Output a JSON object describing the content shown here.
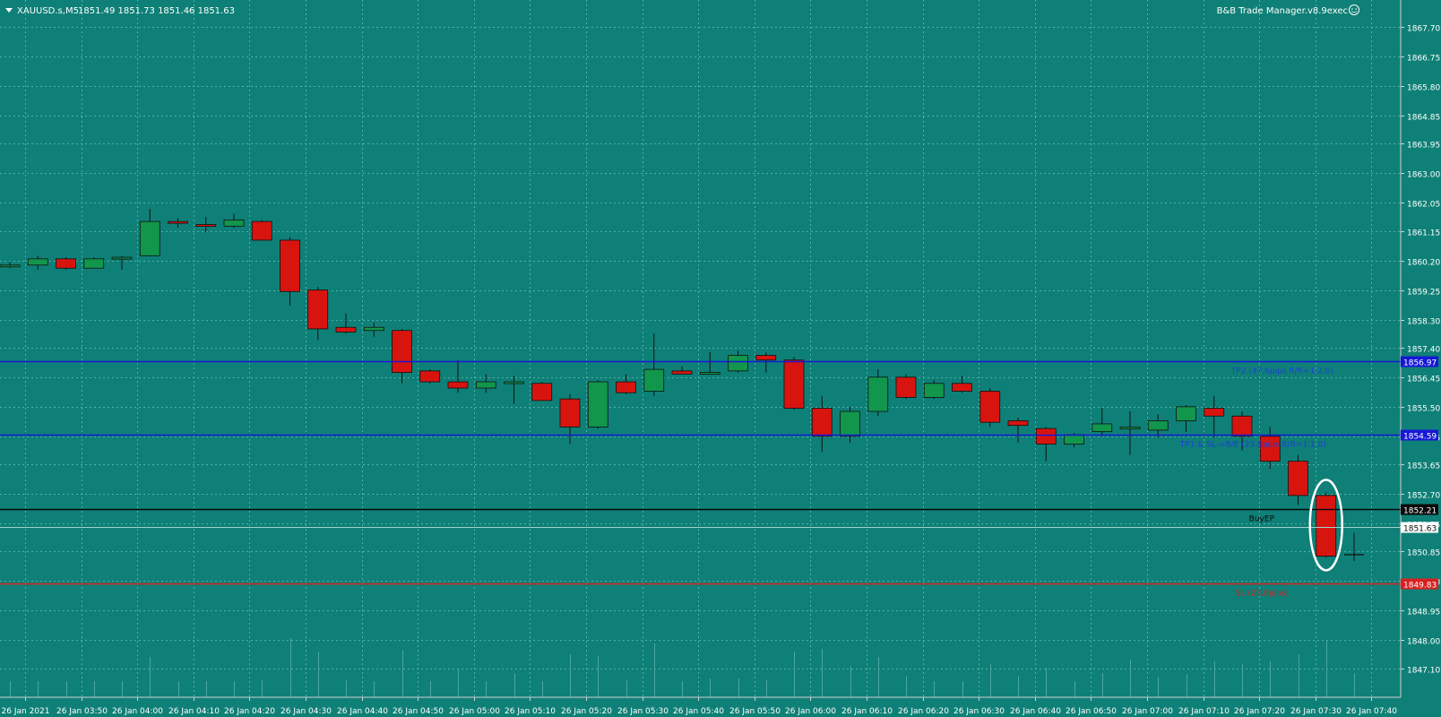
{
  "header": {
    "symbol_label": "XAUUSD.s,M5",
    "ohlc_label": "1851.49 1851.73 1851.46 1851.63",
    "ea_label": "B&B Trade Manager.v8.9exec"
  },
  "colors": {
    "background": "#0f8077",
    "grid": "#4fb0a6",
    "bull": "#11964c",
    "bear": "#d8140f",
    "wick": "#101010",
    "tp_line": "#1717d8",
    "entry_line": "#0a0a0a",
    "sl_line": "#d82020",
    "annotation": "#ffffff"
  },
  "chart_data": {
    "type": "candlestick",
    "symbol": "XAUUSD.s",
    "timeframe": "M5",
    "y_ticks": [
      "1867.70",
      "1866.75",
      "1865.80",
      "1864.85",
      "1863.95",
      "1863.00",
      "1862.05",
      "1861.15",
      "1860.20",
      "1859.25",
      "1858.30",
      "1857.40",
      "1856.45",
      "1855.50",
      "1854.55",
      "1853.65",
      "1852.70",
      "1851.75",
      "1850.85",
      "1849.90",
      "1848.95",
      "1848.00",
      "1847.10"
    ],
    "x_ticks": [
      "26 Jan 2021",
      "26 Jan 03:50",
      "26 Jan 04:00",
      "26 Jan 04:10",
      "26 Jan 04:20",
      "26 Jan 04:30",
      "26 Jan 04:40",
      "26 Jan 04:50",
      "26 Jan 05:00",
      "26 Jan 05:10",
      "26 Jan 05:20",
      "26 Jan 05:30",
      "26 Jan 05:40",
      "26 Jan 05:50",
      "26 Jan 06:00",
      "26 Jan 06:10",
      "26 Jan 06:20",
      "26 Jan 06:30",
      "26 Jan 06:40",
      "26 Jan 06:50",
      "26 Jan 07:00",
      "26 Jan 07:10",
      "26 Jan 07:20",
      "26 Jan 07:30",
      "26 Jan 07:40"
    ],
    "ylim": [
      1847.0,
      1868.1
    ],
    "candles": [
      {
        "o": 1860.05,
        "h": 1860.15,
        "l": 1859.95,
        "c": 1860.05
      },
      {
        "o": 1860.05,
        "h": 1860.35,
        "l": 1859.9,
        "c": 1860.25
      },
      {
        "o": 1860.25,
        "h": 1860.3,
        "l": 1859.9,
        "c": 1859.95
      },
      {
        "o": 1859.95,
        "h": 1860.3,
        "l": 1859.95,
        "c": 1860.25
      },
      {
        "o": 1860.25,
        "h": 1860.35,
        "l": 1859.9,
        "c": 1860.3
      },
      {
        "o": 1860.35,
        "h": 1861.85,
        "l": 1860.35,
        "c": 1861.45
      },
      {
        "o": 1861.45,
        "h": 1861.55,
        "l": 1861.25,
        "c": 1861.4
      },
      {
        "o": 1861.35,
        "h": 1861.6,
        "l": 1861.1,
        "c": 1861.3
      },
      {
        "o": 1861.3,
        "h": 1861.7,
        "l": 1861.25,
        "c": 1861.5
      },
      {
        "o": 1861.45,
        "h": 1861.5,
        "l": 1860.85,
        "c": 1860.85
      },
      {
        "o": 1860.85,
        "h": 1860.95,
        "l": 1858.75,
        "c": 1859.2
      },
      {
        "o": 1859.25,
        "h": 1859.35,
        "l": 1857.65,
        "c": 1858.0
      },
      {
        "o": 1858.05,
        "h": 1858.5,
        "l": 1857.85,
        "c": 1857.9
      },
      {
        "o": 1857.95,
        "h": 1858.2,
        "l": 1857.75,
        "c": 1858.05
      },
      {
        "o": 1857.95,
        "h": 1858.0,
        "l": 1856.25,
        "c": 1856.6
      },
      {
        "o": 1856.65,
        "h": 1856.7,
        "l": 1856.25,
        "c": 1856.3
      },
      {
        "o": 1856.3,
        "h": 1857.0,
        "l": 1855.95,
        "c": 1856.1
      },
      {
        "o": 1856.1,
        "h": 1856.55,
        "l": 1855.95,
        "c": 1856.3
      },
      {
        "o": 1856.25,
        "h": 1856.5,
        "l": 1855.6,
        "c": 1856.3
      },
      {
        "o": 1856.25,
        "h": 1856.3,
        "l": 1855.7,
        "c": 1855.7
      },
      {
        "o": 1855.75,
        "h": 1855.9,
        "l": 1854.3,
        "c": 1854.85
      },
      {
        "o": 1854.85,
        "h": 1856.35,
        "l": 1854.8,
        "c": 1856.3
      },
      {
        "o": 1856.3,
        "h": 1856.55,
        "l": 1855.9,
        "c": 1855.95
      },
      {
        "o": 1856.0,
        "h": 1857.85,
        "l": 1855.85,
        "c": 1856.7
      },
      {
        "o": 1856.65,
        "h": 1856.8,
        "l": 1856.55,
        "c": 1856.55
      },
      {
        "o": 1856.6,
        "h": 1857.25,
        "l": 1856.55,
        "c": 1856.6
      },
      {
        "o": 1856.65,
        "h": 1857.3,
        "l": 1856.6,
        "c": 1857.15
      },
      {
        "o": 1857.15,
        "h": 1857.25,
        "l": 1856.6,
        "c": 1857.0
      },
      {
        "o": 1857.0,
        "h": 1857.1,
        "l": 1855.4,
        "c": 1855.45
      },
      {
        "o": 1855.45,
        "h": 1855.85,
        "l": 1854.05,
        "c": 1854.55
      },
      {
        "o": 1854.55,
        "h": 1855.5,
        "l": 1854.35,
        "c": 1855.35
      },
      {
        "o": 1855.35,
        "h": 1856.7,
        "l": 1855.2,
        "c": 1856.45
      },
      {
        "o": 1856.45,
        "h": 1856.55,
        "l": 1855.75,
        "c": 1855.8
      },
      {
        "o": 1855.8,
        "h": 1856.35,
        "l": 1855.75,
        "c": 1856.25
      },
      {
        "o": 1856.25,
        "h": 1856.5,
        "l": 1855.95,
        "c": 1856.0
      },
      {
        "o": 1856.0,
        "h": 1856.1,
        "l": 1854.85,
        "c": 1855.0
      },
      {
        "o": 1855.05,
        "h": 1855.15,
        "l": 1854.35,
        "c": 1854.9
      },
      {
        "o": 1854.8,
        "h": 1854.85,
        "l": 1853.75,
        "c": 1854.3
      },
      {
        "o": 1854.3,
        "h": 1854.65,
        "l": 1854.2,
        "c": 1854.6
      },
      {
        "o": 1854.7,
        "h": 1855.45,
        "l": 1854.55,
        "c": 1854.95
      },
      {
        "o": 1854.85,
        "h": 1855.35,
        "l": 1853.95,
        "c": 1854.85
      },
      {
        "o": 1854.75,
        "h": 1855.25,
        "l": 1854.5,
        "c": 1855.05
      },
      {
        "o": 1855.05,
        "h": 1855.55,
        "l": 1854.7,
        "c": 1855.5
      },
      {
        "o": 1855.45,
        "h": 1855.85,
        "l": 1854.5,
        "c": 1855.2
      },
      {
        "o": 1855.2,
        "h": 1855.35,
        "l": 1854.1,
        "c": 1854.55
      },
      {
        "o": 1854.55,
        "h": 1854.85,
        "l": 1853.5,
        "c": 1853.75
      },
      {
        "o": 1853.75,
        "h": 1853.95,
        "l": 1852.35,
        "c": 1852.65
      },
      {
        "o": 1852.65,
        "h": 1852.75,
        "l": 1850.65,
        "c": 1850.7
      },
      {
        "o": 1850.75,
        "h": 1851.45,
        "l": 1850.55,
        "c": 1850.75
      }
    ],
    "horizontal_lines": [
      {
        "name": "TP2",
        "price": "1856.97",
        "label": "TP2 (47.6pips R/R=1:2.0)"
      },
      {
        "name": "TP1",
        "price": "1854.59",
        "label": "TP1 & SL->B/E (23.8pips R/R=1:1.0)"
      },
      {
        "name": "BuyEP",
        "price": "1852.21",
        "label": "BuyEP"
      },
      {
        "name": "SL",
        "price": "1849.83",
        "label": "SL (23.8pips)"
      }
    ],
    "current_price": "1851.63",
    "current_price_value": 1851.63,
    "highlighted_candle_index": 47
  }
}
